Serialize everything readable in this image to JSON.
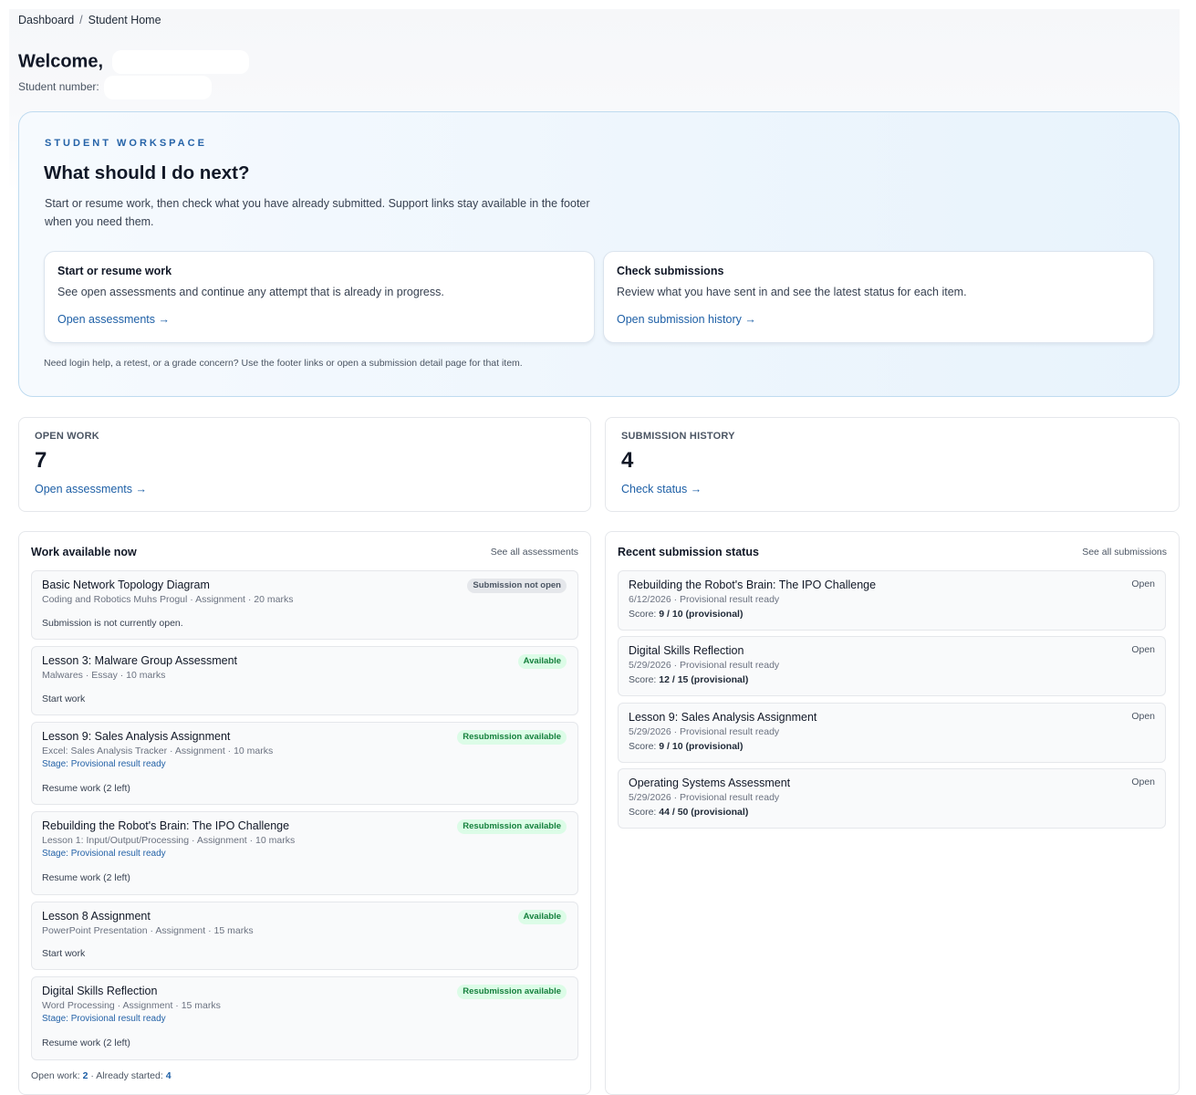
{
  "breadcrumb": {
    "items": [
      "Dashboard",
      "Student Home"
    ],
    "separator": "/"
  },
  "header": {
    "welcome_label": "Welcome,",
    "student_number_label": "Student number:"
  },
  "workspace": {
    "kicker": "STUDENT WORKSPACE",
    "title": "What should I do next?",
    "description": "Start or resume work, then check what you have already submitted. Support links stay available in the footer when you need them.",
    "cards": [
      {
        "title": "Start or resume work",
        "description": "See open assessments and continue any attempt that is already in progress.",
        "link": "Open assessments →"
      },
      {
        "title": "Check submissions",
        "description": "Review what you have sent in and see the latest status for each item.",
        "link": "Open submission history →"
      }
    ],
    "help_text": "Need login help, a retest, or a grade concern? Use the footer links or open a submission detail page for that item."
  },
  "stats": [
    {
      "label": "OPEN WORK",
      "value": "7",
      "link": "Open assessments →"
    },
    {
      "label": "SUBMISSION HISTORY",
      "value": "4",
      "link": "Check status →"
    }
  ],
  "work_panel": {
    "title": "Work available now",
    "see_all": "See all assessments",
    "items": [
      {
        "title": "Basic Network Topology Diagram",
        "meta": "Coding and Robotics Muhs Progul · Assignment · 20 marks",
        "badge": "Submission not open",
        "badge_tone": "gray",
        "stage": "",
        "action": "Submission is not currently open."
      },
      {
        "title": "Lesson 3: Malware Group Assessment",
        "meta": "Malwares · Essay · 10 marks",
        "badge": "Available",
        "badge_tone": "green",
        "stage": "",
        "action": "Start work"
      },
      {
        "title": "Lesson 9: Sales Analysis Assignment",
        "meta": "Excel: Sales Analysis Tracker · Assignment · 10 marks",
        "badge": "Resubmission available",
        "badge_tone": "green",
        "stage": "Stage: Provisional result ready",
        "action": "Resume work (2 left)"
      },
      {
        "title": "Rebuilding the Robot's Brain: The IPO Challenge",
        "meta": "Lesson 1: Input/Output/Processing · Assignment · 10 marks",
        "badge": "Resubmission available",
        "badge_tone": "green",
        "stage": "Stage: Provisional result ready",
        "action": "Resume work (2 left)"
      },
      {
        "title": "Lesson 8 Assignment",
        "meta": "PowerPoint Presentation · Assignment · 15 marks",
        "badge": "Available",
        "badge_tone": "green",
        "stage": "",
        "action": "Start work"
      },
      {
        "title": "Digital Skills Reflection",
        "meta": "Word Processing · Assignment · 15 marks",
        "badge": "Resubmission available",
        "badge_tone": "green",
        "stage": "Stage: Provisional result ready",
        "action": "Resume work (2 left)"
      }
    ],
    "footer": {
      "open_label": "Open work:",
      "open_value": "2",
      "sep": "·",
      "started_label": "Already started:",
      "started_value": "4"
    }
  },
  "submission_panel": {
    "title": "Recent submission status",
    "see_all": "See all submissions",
    "items": [
      {
        "title": "Rebuilding the Robot's Brain: The IPO Challenge",
        "meta": "6/12/2026 · Provisional result ready",
        "score_label": "Score:",
        "score": "9 / 10 (provisional)",
        "status": "Open"
      },
      {
        "title": "Digital Skills Reflection",
        "meta": "5/29/2026 · Provisional result ready",
        "score_label": "Score:",
        "score": "12 / 15 (provisional)",
        "status": "Open"
      },
      {
        "title": "Lesson 9: Sales Analysis Assignment",
        "meta": "5/29/2026 · Provisional result ready",
        "score_label": "Score:",
        "score": "9 / 10 (provisional)",
        "status": "Open"
      },
      {
        "title": "Operating Systems Assessment",
        "meta": "5/29/2026 · Provisional result ready",
        "score_label": "Score:",
        "score": "44 / 50 (provisional)",
        "status": "Open"
      }
    ]
  },
  "colors": {
    "link": "#1d5fa6",
    "badge_green_bg": "#dcfce7",
    "badge_green_text": "#15803d",
    "badge_gray_bg": "#e5e7eb",
    "workspace_border": "#bfdbf0"
  }
}
